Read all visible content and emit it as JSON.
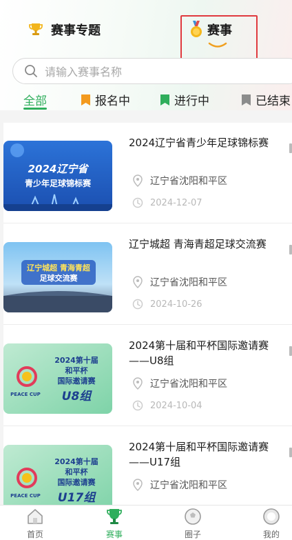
{
  "header": {
    "tab_special": "赛事专题",
    "tab_events": "赛事"
  },
  "search": {
    "placeholder": "请输入赛事名称"
  },
  "filters": {
    "all": "全部",
    "registering": "报名中",
    "ongoing": "进行中",
    "ended": "已结束"
  },
  "events": [
    {
      "title": "2024辽宁省青少年足球锦标赛",
      "location": "辽宁省沈阳和平区",
      "date": "2024-12-07",
      "poster_lines": [
        "2024辽宁省",
        "青少年足球锦标赛"
      ]
    },
    {
      "title": "辽宁城超 青海青超足球交流赛",
      "location": "辽宁省沈阳和平区",
      "date": "2024-10-26",
      "poster_lines": [
        "辽宁城超 青海青超",
        "足球交流赛"
      ]
    },
    {
      "title": "2024第十届和平杯国际邀请赛——U8组",
      "location": "辽宁省沈阳和平区",
      "date": "2024-10-04",
      "poster_lines": [
        "2024第十届",
        "和平杯",
        "国际邀请赛",
        "U8组"
      ],
      "poster_logo": "PEACE CUP"
    },
    {
      "title": "2024第十届和平杯国际邀请赛——U17组",
      "location": "辽宁省沈阳和平区",
      "date": "",
      "poster_lines": [
        "2024第十届",
        "和平杯",
        "国际邀请赛",
        "U17组"
      ],
      "poster_logo": "PEACE CUP"
    }
  ],
  "nav": {
    "home": "首页",
    "events": "赛事",
    "circle": "圈子",
    "mine": "我的"
  },
  "colors": {
    "accent": "#2fae5c",
    "highlight": "#e0393e",
    "registering_flag": "#f39a1e",
    "ongoing_flag": "#2fae5c",
    "ended_flag": "#8c8c8c"
  },
  "icons": [
    "trophy-icon",
    "medal-icon",
    "search-icon",
    "flag-icon",
    "pin-icon",
    "clock-icon",
    "home-icon",
    "whistle-icon",
    "ball-icon",
    "profile-icon"
  ]
}
